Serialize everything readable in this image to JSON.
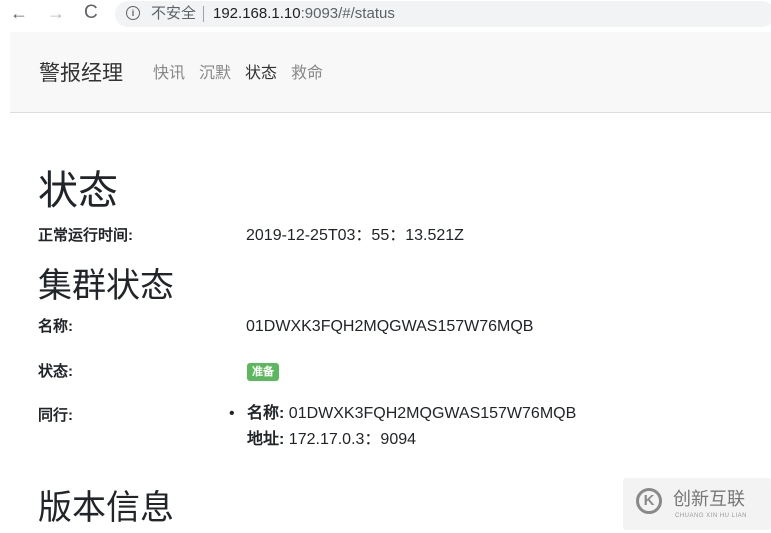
{
  "browser": {
    "back_icon": "←",
    "forward_icon": "→",
    "reload_icon": "C",
    "info_icon": "i",
    "security_label": "不安全",
    "url_host": "192.168.1.10",
    "url_rest": ":9093/#/status"
  },
  "navbar": {
    "brand": "警报经理",
    "links": [
      {
        "label": "快讯",
        "active": false
      },
      {
        "label": "沉默",
        "active": false
      },
      {
        "label": "状态",
        "active": true
      },
      {
        "label": "救命",
        "active": false
      }
    ]
  },
  "status": {
    "title": "状态",
    "uptime_label": "正常运行时间:",
    "uptime_value": "2019-12-25T03：55：13.521Z"
  },
  "cluster": {
    "title": "集群状态",
    "name_label": "名称:",
    "name_value": "01DWXK3FQH2MQGWAS157W76MQB",
    "status_label": "状态:",
    "status_badge": "准备",
    "peers_label": "同行:",
    "peers": [
      {
        "name_key": "名称:",
        "name_value": "01DWXK3FQH2MQGWAS157W76MQB",
        "address_key": "地址:",
        "address_value": "172.17.0.3：9094"
      }
    ]
  },
  "version": {
    "title": "版本信息"
  },
  "watermark": {
    "logo_glyph": "K",
    "text": "创新互联",
    "sub": "CHUANG XIN HU LIAN"
  },
  "colors": {
    "badge_success": "#5cb85c",
    "navbar_bg": "#f8f8f8"
  }
}
